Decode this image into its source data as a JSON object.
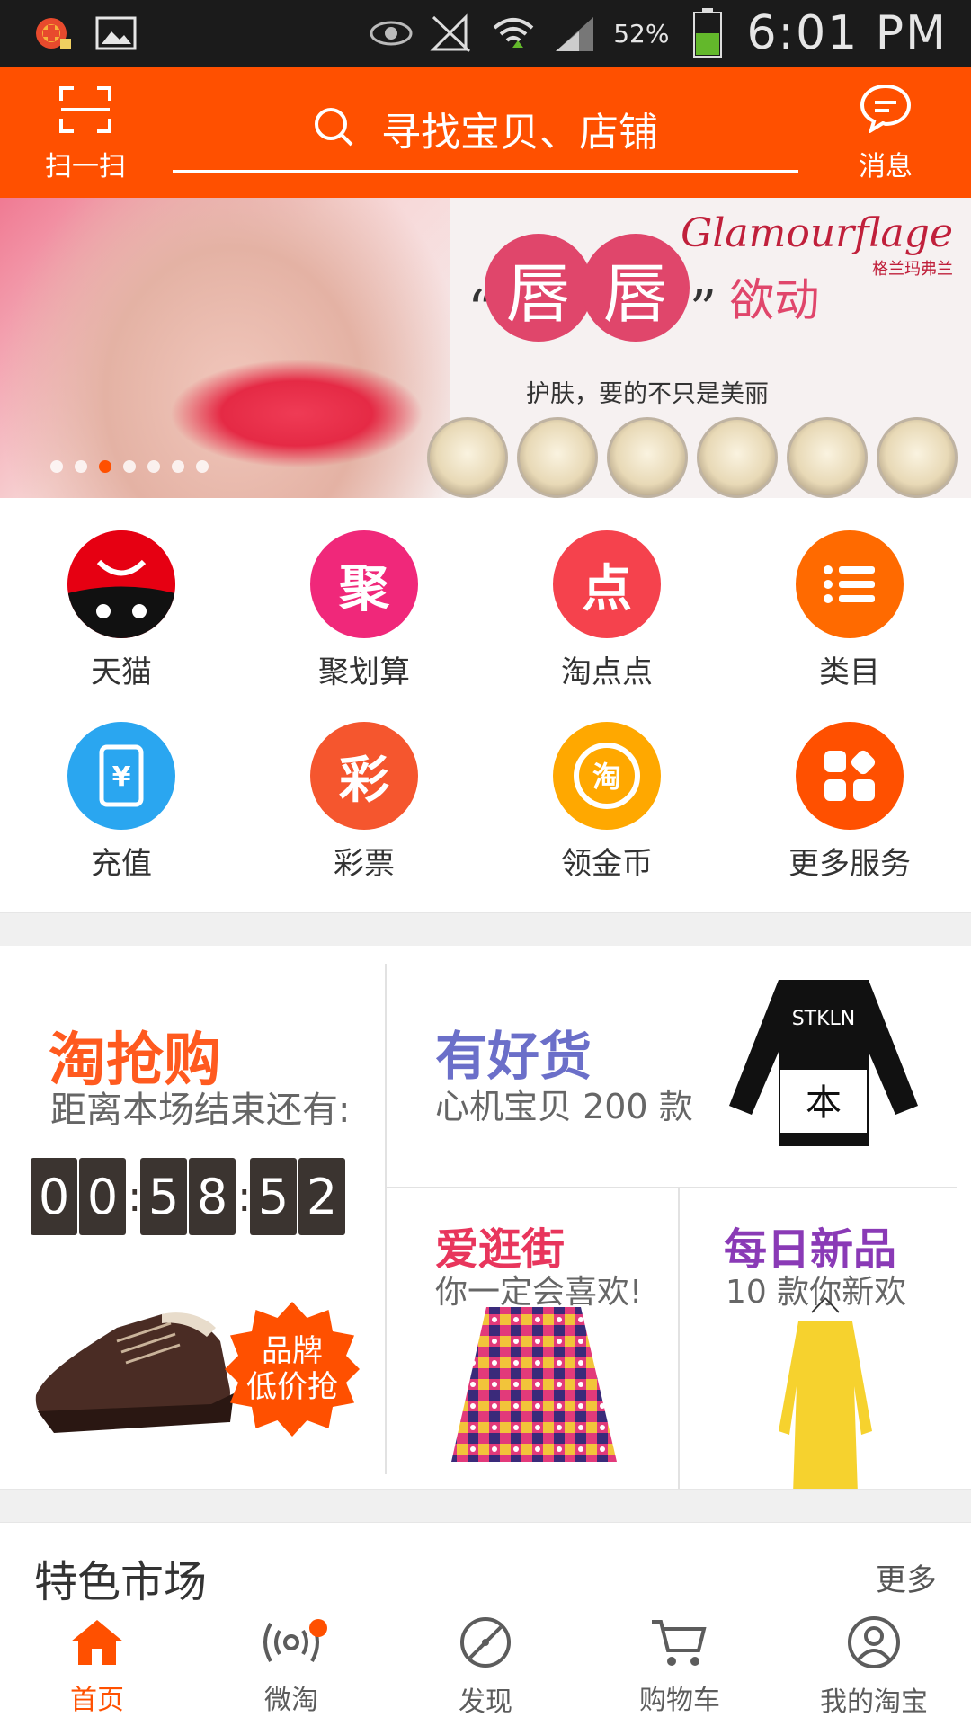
{
  "status_bar": {
    "battery": "52%",
    "time": "6:01 PM"
  },
  "header": {
    "scan_label": "扫一扫",
    "search_placeholder": "寻找宝贝、店铺",
    "message_label": "消息"
  },
  "banner": {
    "brand": "Glamourflage",
    "brand_cn": "格兰玛弗兰",
    "headline_char_1": "唇",
    "headline_char_2": "唇",
    "headline_suffix": "欲动",
    "subtitle": "护肤，要的不只是美丽",
    "slide_count": 7,
    "active_slide": 3
  },
  "quick_grid": [
    {
      "label": "天猫",
      "icon": "tmall-icon",
      "glyph": "",
      "color": "#e60012"
    },
    {
      "label": "聚划算",
      "icon": "juhuasuan-icon",
      "glyph": "聚",
      "color": "#f0287a"
    },
    {
      "label": "淘点点",
      "icon": "taodiandian-icon",
      "glyph": "点",
      "color": "#f5424d"
    },
    {
      "label": "类目",
      "icon": "category-list-icon",
      "glyph": "",
      "color": "#ff6a00"
    },
    {
      "label": "充值",
      "icon": "phone-recharge-icon",
      "glyph": "¥",
      "color": "#2aa6f0"
    },
    {
      "label": "彩票",
      "icon": "lottery-icon",
      "glyph": "彩",
      "color": "#f5562e"
    },
    {
      "label": "领金币",
      "icon": "gold-coin-icon",
      "glyph": "淘",
      "color": "#ffa800"
    },
    {
      "label": "更多服务",
      "icon": "more-services-icon",
      "glyph": "",
      "color": "#ff5000"
    }
  ],
  "promo": {
    "qiang": {
      "title": "淘抢购",
      "subtitle": "距离本场结束还有:",
      "countdown_digits": [
        "0",
        "0",
        "5",
        "8",
        "5",
        "2"
      ],
      "burst_line1": "品牌",
      "burst_line2": "低价抢"
    },
    "haohuo": {
      "title": "有好货",
      "subtitle": "心机宝贝 200 款"
    },
    "guangjie": {
      "title": "爱逛街",
      "subtitle": "你一定会喜欢!"
    },
    "xinpin": {
      "title": "每日新品",
      "subtitle": "10 款你新欢"
    }
  },
  "market": {
    "title": "特色市场",
    "more": "更多"
  },
  "bottom_nav": [
    {
      "label": "首页",
      "icon": "home-icon",
      "active": true
    },
    {
      "label": "微淘",
      "icon": "weitao-broadcast-icon",
      "active": false,
      "badge": true
    },
    {
      "label": "发现",
      "icon": "discover-compass-icon",
      "active": false
    },
    {
      "label": "购物车",
      "icon": "cart-icon",
      "active": false
    },
    {
      "label": "我的淘宝",
      "icon": "profile-icon",
      "active": false
    }
  ],
  "colors": {
    "brand_orange": "#ff5000",
    "statusbar": "#1b1b1b"
  }
}
